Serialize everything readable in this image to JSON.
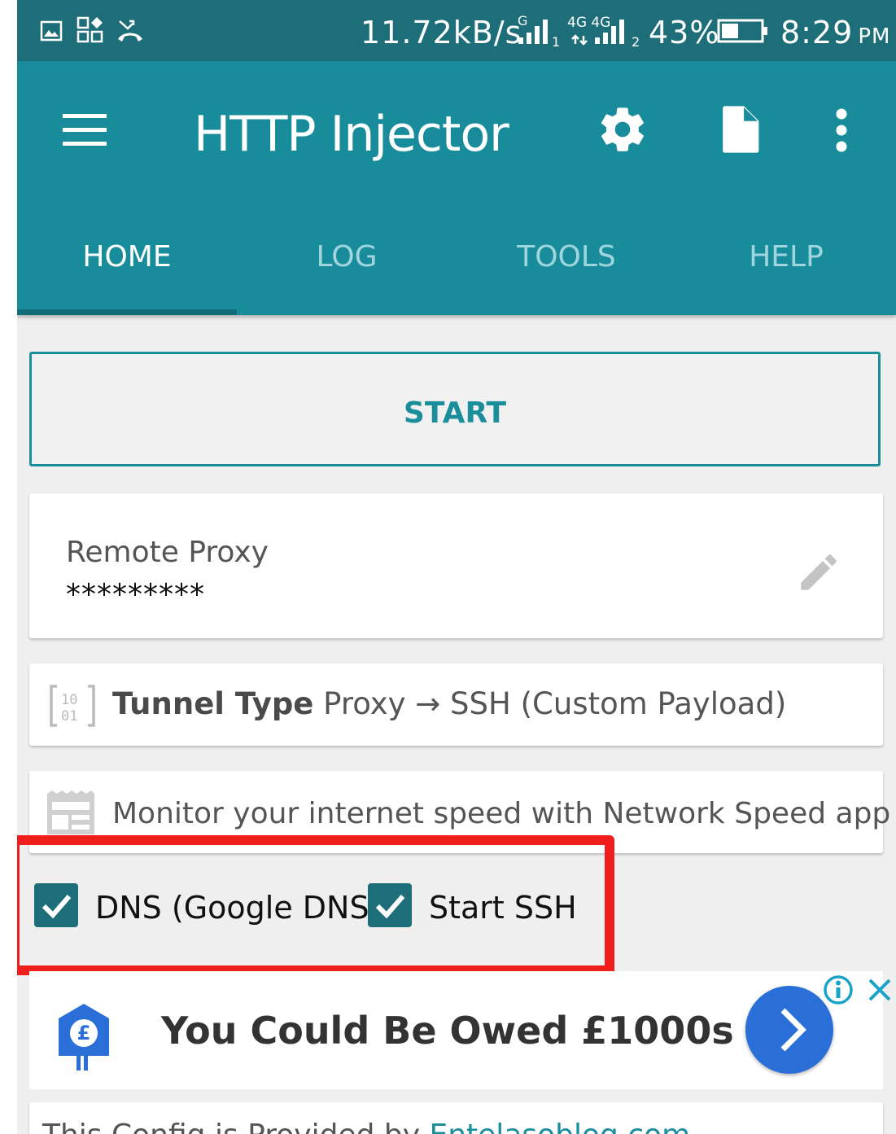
{
  "status_bar": {
    "speed": "11.72kB/s",
    "sim1_network": "G",
    "sim1_slot": "1",
    "sim2_network": "4G 4G",
    "sim2_slot": "2",
    "battery": "43%",
    "battery_level": 0.43,
    "time": "8:29",
    "ampm": "PM",
    "icons": [
      "gallery-icon",
      "apps-icon",
      "missed-call-icon",
      "signal-icon",
      "battery-icon"
    ]
  },
  "app_bar": {
    "title": "HTTP Injector",
    "actions": [
      "gear-icon",
      "file-icon",
      "more-vert-icon"
    ]
  },
  "tabs": [
    {
      "label": "HOME",
      "active": true
    },
    {
      "label": "LOG",
      "active": false
    },
    {
      "label": "TOOLS",
      "active": false
    },
    {
      "label": "HELP",
      "active": false
    }
  ],
  "start_button": {
    "label": "START"
  },
  "remote_proxy": {
    "label": "Remote Proxy",
    "value": "*********"
  },
  "tunnel": {
    "label": "Tunnel Type",
    "value": "Proxy → SSH (Custom Payload)",
    "icon": "binary-icon"
  },
  "promo": {
    "text": "Monitor your internet speed with Network Speed app",
    "icon": "newspaper-icon"
  },
  "options": [
    {
      "label": "DNS (Google DNS)",
      "checked": true
    },
    {
      "label": "Start SSH",
      "checked": true
    }
  ],
  "ad_banner": {
    "text": "You Could Be Owed £1000s",
    "logo_symbol": "£"
  },
  "footer": {
    "text": "This Config is Provided by ",
    "link": "Entelasoblog.com"
  },
  "colors": {
    "primary": "#198c9c",
    "primary_dark": "#1d6e79",
    "highlight": "#f01d1d",
    "ad_button": "#2a6fd8"
  }
}
